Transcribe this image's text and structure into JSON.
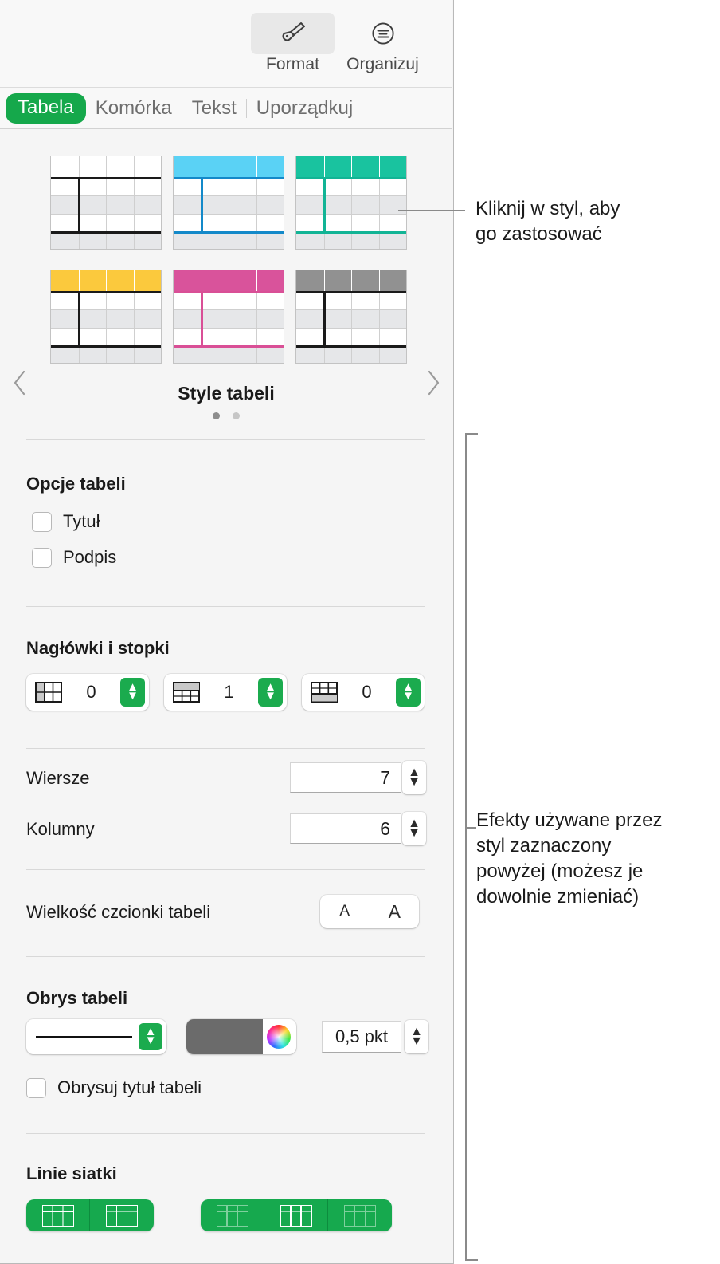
{
  "toolbar": {
    "buttons": [
      {
        "label": "Format",
        "icon": "paintbrush-icon",
        "active": true
      },
      {
        "label": "Organizuj",
        "icon": "arrange-icon",
        "active": false
      }
    ]
  },
  "tabs": [
    {
      "label": "Tabela",
      "active": true
    },
    {
      "label": "Komórka",
      "active": false
    },
    {
      "label": "Tekst",
      "active": false
    },
    {
      "label": "Uporządkuj",
      "active": false
    }
  ],
  "gallery": {
    "title": "Style tabeli",
    "prev_icon": "chevron-left-icon",
    "next_icon": "chevron-right-icon",
    "page_dots": [
      true,
      false
    ],
    "styles": [
      {
        "name": "styl-bialy",
        "accent": "#1a1a1a",
        "header": "#ffffff",
        "header_text_sep": "#cfcfcf",
        "selected": false
      },
      {
        "name": "styl-niebieski",
        "accent": "#1389c9",
        "header": "#5ad2f5",
        "header_text_sep": "#ffffff",
        "selected": false
      },
      {
        "name": "styl-zielony",
        "accent": "#12b495",
        "header": "#19c39f",
        "header_text_sep": "#ffffff",
        "selected": true
      },
      {
        "name": "styl-zolty",
        "accent": "#1a1a1a",
        "header": "#fbc93d",
        "header_text_sep": "#ffffff",
        "selected": false
      },
      {
        "name": "styl-rozowy",
        "accent": "#d94f96",
        "header": "#d9539b",
        "header_text_sep": "#ffffff",
        "selected": false
      },
      {
        "name": "styl-szary",
        "accent": "#1a1a1a",
        "header": "#919191",
        "header_text_sep": "#ffffff",
        "selected": false
      }
    ]
  },
  "table_options": {
    "title": "Opcje tabeli",
    "checkboxes": [
      {
        "label": "Tytuł",
        "checked": false
      },
      {
        "label": "Podpis",
        "checked": false
      }
    ]
  },
  "headers_footers": {
    "title": "Nagłówki i stopki",
    "fields": [
      {
        "icon": "header-columns-icon",
        "value": "0"
      },
      {
        "icon": "header-rows-icon",
        "value": "1"
      },
      {
        "icon": "footer-rows-icon",
        "value": "0"
      }
    ]
  },
  "dimensions": {
    "rows": {
      "label": "Wiersze",
      "value": "7"
    },
    "columns": {
      "label": "Kolumny",
      "value": "6"
    }
  },
  "font_size": {
    "label": "Wielkość czcionki tabeli",
    "decrease": "A",
    "increase": "A"
  },
  "table_outline": {
    "title": "Obrys tabeli",
    "stroke_style_icon": "solid-line-icon",
    "color_swatch": "#6b6b6b",
    "color_wheel_icon": "color-wheel-icon",
    "width_value": "0,5 pkt",
    "checkbox": {
      "label": "Obrysuj tytuł tabeli",
      "checked": false
    }
  },
  "gridlines": {
    "title": "Linie siatki",
    "group_a": [
      {
        "name": "poziome-linie-siatki",
        "icon": "grid-horizontal-icon",
        "active": true
      },
      {
        "name": "pionowe-linie-siatki",
        "icon": "grid-vertical-icon",
        "active": true
      }
    ],
    "group_b": [
      {
        "name": "obramowanie-naglowka-poziome",
        "icon": "grid-header-h-icon",
        "active": false
      },
      {
        "name": "obramowanie-naglowka-pionowe",
        "icon": "grid-header-v-icon",
        "active": true
      },
      {
        "name": "obramowanie-stopki",
        "icon": "grid-footer-icon",
        "active": false
      }
    ]
  },
  "callouts": [
    {
      "name": "callout-styles",
      "lines": [
        "Kliknij w styl, aby",
        "go zastosować"
      ]
    },
    {
      "name": "callout-effects",
      "lines": [
        "Efekty używane przez",
        "styl zaznaczony",
        "powyżej (możesz je",
        "dowolnie zmieniać)"
      ]
    }
  ],
  "colors": {
    "accent_green": "#15a84b",
    "stepper_green": "#1bab4e",
    "gridline_green": "#16a94e",
    "panel_bg": "#f5f5f5",
    "toolbar_bg": "#f8f8f8",
    "leader_gray": "#8a8a8a"
  }
}
